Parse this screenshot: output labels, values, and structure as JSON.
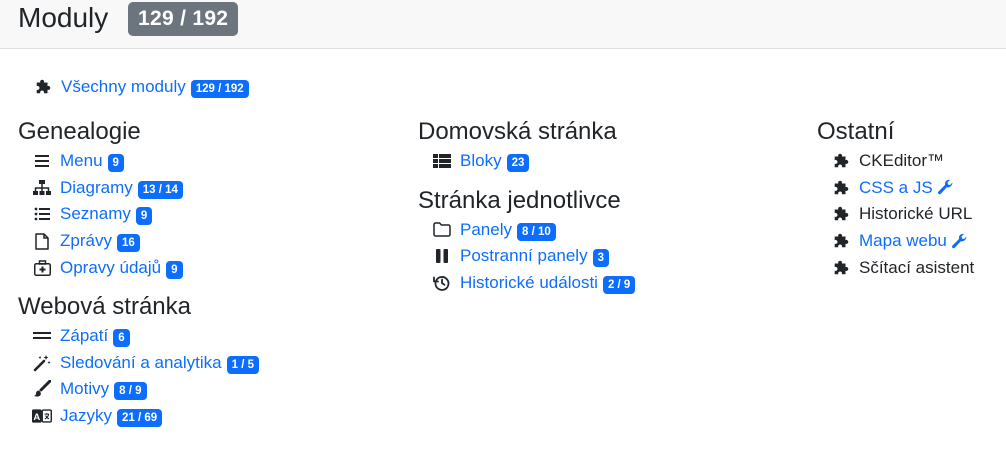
{
  "header": {
    "title": "Moduly",
    "count_badge": "129 / 192"
  },
  "all_modules": {
    "label": "Všechny moduly",
    "badge": "129 / 192",
    "icon": "puzzle-icon"
  },
  "columns": [
    {
      "sections": [
        {
          "title": "Genealogie",
          "items": [
            {
              "label": "Menu",
              "badge": "9",
              "icon": "bars-icon"
            },
            {
              "label": "Diagramy",
              "badge": "13 / 14",
              "icon": "sitemap-icon"
            },
            {
              "label": "Seznamy",
              "badge": "9",
              "icon": "list-icon"
            },
            {
              "label": "Zprávy",
              "badge": "16",
              "icon": "file-icon"
            },
            {
              "label": "Opravy údajů",
              "badge": "9",
              "icon": "medkit-icon"
            }
          ]
        },
        {
          "title": "Webová stránka",
          "items": [
            {
              "label": "Zápatí",
              "badge": "6",
              "icon": "equals-icon"
            },
            {
              "label": "Sledování a analytika",
              "badge": "1 / 5",
              "icon": "magic-wand-icon"
            },
            {
              "label": "Motivy",
              "badge": "8 / 9",
              "icon": "paint-brush-icon"
            },
            {
              "label": "Jazyky",
              "badge": "21 / 69",
              "icon": "language-icon"
            }
          ]
        }
      ]
    },
    {
      "sections": [
        {
          "title": "Domovská stránka",
          "items": [
            {
              "label": "Bloky",
              "badge": "23",
              "icon": "th-list-icon"
            }
          ]
        },
        {
          "title": "Stránka jednotlivce",
          "items": [
            {
              "label": "Panely",
              "badge": "8 / 10",
              "icon": "folder-icon"
            },
            {
              "label": "Postranní panely",
              "badge": "3",
              "icon": "pause-icon"
            },
            {
              "label": "Historické události",
              "badge": "2 / 9",
              "icon": "history-icon"
            }
          ]
        }
      ]
    },
    {
      "sections": [
        {
          "title": "Ostatní",
          "items": [
            {
              "label": "CKEditor™",
              "icon": "puzzle-icon",
              "link": false
            },
            {
              "label": "CSS a JS",
              "icon": "puzzle-icon",
              "link": true,
              "wrench": true
            },
            {
              "label": "Historické URL",
              "icon": "puzzle-icon",
              "link": false
            },
            {
              "label": "Mapa webu",
              "icon": "puzzle-icon",
              "link": true,
              "wrench": true
            },
            {
              "label": "Sčítací asistent",
              "icon": "puzzle-icon",
              "link": false
            }
          ]
        }
      ]
    }
  ],
  "colors": {
    "link": "#0d6efd",
    "badge": "#0d6efd",
    "title_badge": "#6c757d",
    "header_bg": "#f8f8f8"
  }
}
